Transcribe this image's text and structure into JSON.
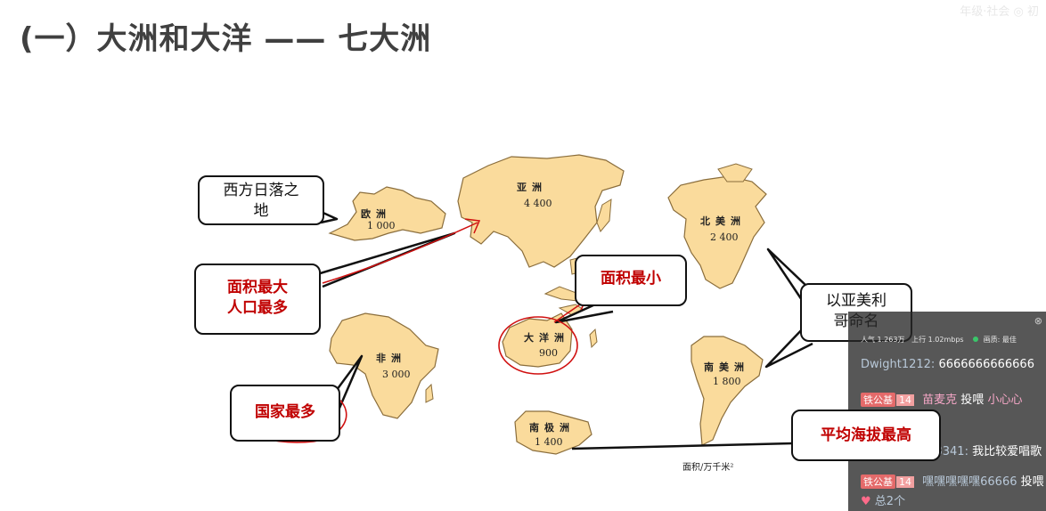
{
  "slide": {
    "title": "(一）大洲和大洋 —— 七大洲",
    "watermark": "年级·社会 ◎ 初"
  },
  "continents": {
    "europe": {
      "name": "欧洲",
      "area": "1 000"
    },
    "asia": {
      "name": "亚洲",
      "area": "4 400"
    },
    "north_america": {
      "name": "北美洲",
      "area": "2 400"
    },
    "africa": {
      "name": "非洲",
      "area": "3 000"
    },
    "oceania": {
      "name": "大洋洲",
      "area": "900"
    },
    "south_america": {
      "name": "南美洲",
      "area": "1 800"
    },
    "antarctica": {
      "name": "南极洲",
      "area": "1 400"
    }
  },
  "map_caption": "面积/万千米²",
  "colors": {
    "land": "#fadb9c",
    "coast": "#8a6d3b",
    "annotation_red": "#d01010",
    "callout_red_text": "#c00000"
  },
  "callouts": {
    "europe": {
      "line1": "西方日落之",
      "line2": "地"
    },
    "asia": {
      "line1": "面积最大",
      "line2": "人口最多"
    },
    "oceania": {
      "text": "面积最小"
    },
    "africa": {
      "text": "国家最多"
    },
    "america": {
      "line1": "以亚美利",
      "line2": "哥命名"
    },
    "antarctica": {
      "text": "平均海拔最高"
    }
  },
  "chat": {
    "close_icon": "close-icon",
    "stats": {
      "popularity": "人气 1.263万",
      "upload": "上行 1.02mbps",
      "quality": "画质: 最佳"
    },
    "messages": [
      {
        "user": "Dwight1212:",
        "text": "6666666666666"
      },
      {
        "badge": "铁公基",
        "level": "14",
        "user": "苗麦克",
        "action": "投喂",
        "text": "小心心"
      },
      {
        "text": "↑"
      },
      {
        "user": "bili_91306423341:",
        "text": "我比较爱唱歌"
      },
      {
        "badge": "铁公基",
        "level": "14",
        "user": "嘿嘿嘿嘿嘿66666",
        "action": "投喂"
      },
      {
        "icon": "heart-icon",
        "text": "总2个"
      }
    ]
  }
}
